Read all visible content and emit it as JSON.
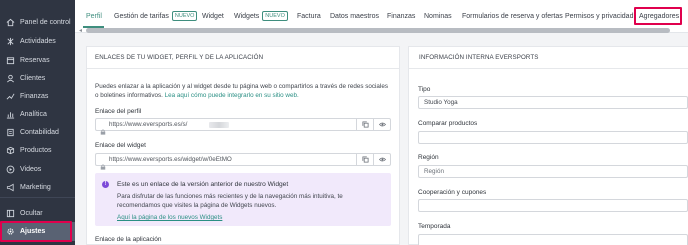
{
  "sidebar": {
    "items": [
      {
        "label": "Panel de control",
        "icon": "home-icon",
        "active": false
      },
      {
        "label": "Actividades",
        "icon": "activity-icon",
        "active": false
      },
      {
        "label": "Reservas",
        "icon": "calendar-icon",
        "active": false
      },
      {
        "label": "Clientes",
        "icon": "users-icon",
        "active": false
      },
      {
        "label": "Finanzas",
        "icon": "finance-icon",
        "active": false
      },
      {
        "label": "Analítica",
        "icon": "chart-icon",
        "active": false
      },
      {
        "label": "Contabilidad",
        "icon": "accounting-icon",
        "active": false
      },
      {
        "label": "Productos",
        "icon": "box-icon",
        "active": false
      },
      {
        "label": "Videos",
        "icon": "video-icon",
        "active": false
      },
      {
        "label": "Marketing",
        "icon": "megaphone-icon",
        "active": false
      },
      {
        "label": "Ocultar",
        "icon": "collapse-icon",
        "active": false
      },
      {
        "label": "Ajustes",
        "icon": "gear-icon",
        "active": true
      }
    ]
  },
  "tabs": {
    "items": [
      {
        "label": "Perfil",
        "active": true
      },
      {
        "label": "Gestión de tarifas",
        "badge": "NUEVO"
      },
      {
        "label": "Widget"
      },
      {
        "label": "Widgets",
        "badge": "NUEVO"
      },
      {
        "label": "Factura"
      },
      {
        "label": "Datos maestros"
      },
      {
        "label": "Finanzas"
      },
      {
        "label": "Nominas"
      },
      {
        "label": "Formularios de reserva y ofertas"
      },
      {
        "label": "Permisos y privacidad"
      },
      {
        "label": "Agregadores"
      }
    ]
  },
  "left_card": {
    "title": "ENLACES DE TU WIDGET, PERFIL Y DE LA APLICACIÓN",
    "intro_line1": "Puedes enlazar a la aplicación y al widget desde tu página web o compartirlos a través de redes sociales",
    "intro_line2_prefix": "o boletines informativos. ",
    "intro_link": "Lea aquí cómo puede integrarlo en su sitio web.",
    "profile_label": "Enlace del perfil",
    "profile_url": "https://www.eversports.es/s/",
    "widget_label": "Enlace del widget",
    "widget_url": "https://www.eversports.es/widget/w/0eEtMO",
    "notice_title": "Este es un enlace de la versión anterior de nuestro Widget",
    "notice_body1": "Para disfrutar de las funciones más recientes y de la navegación más intuitiva, te",
    "notice_body2": "recomendamos que visites la página de Widgets nuevos.",
    "notice_link": "Aquí la página de los nuevos Widgets",
    "app_label": "Enlace de la aplicación"
  },
  "right_card": {
    "title": "INFORMACIÓN INTERNA EVERSPORTS",
    "fields": [
      {
        "label": "Tipo",
        "value": "Studio Yoga"
      },
      {
        "label": "Comparar productos",
        "value": ""
      },
      {
        "label": "Región",
        "value": "Región"
      },
      {
        "label": "Cooperación y cupones",
        "value": ""
      },
      {
        "label": "Temporada",
        "value": ""
      }
    ]
  },
  "colors": {
    "sidebar_bg": "#2f3542",
    "accent": "#3e8e7e",
    "highlight": "#e0004d",
    "notice_bg": "#f1e9fb",
    "notice_icon": "#7d4bd8"
  }
}
